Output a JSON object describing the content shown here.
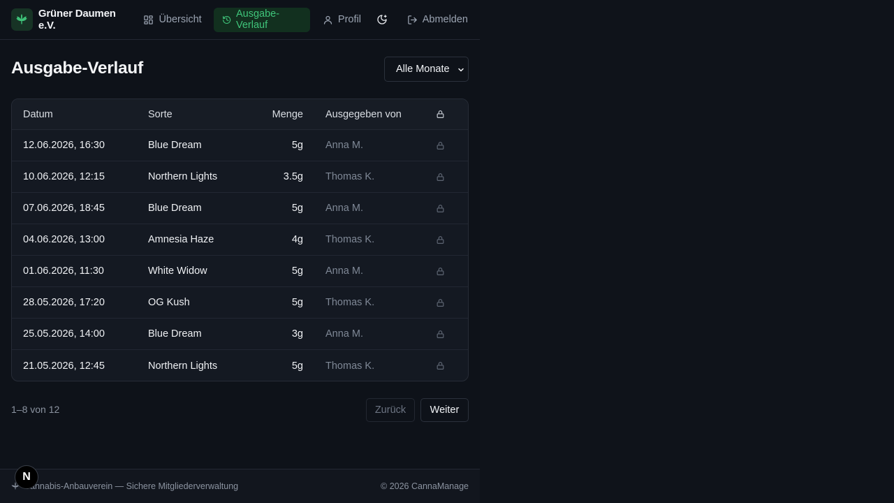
{
  "brand": {
    "name": "Grüner Daumen e.V."
  },
  "nav": {
    "overview": "Übersicht",
    "history": "Ausgabe-Verlauf",
    "profile": "Profil",
    "logout": "Abmelden"
  },
  "page": {
    "title": "Ausgabe-Verlauf",
    "filter_selected": "Alle Monate"
  },
  "table": {
    "columns": [
      "Datum",
      "Sorte",
      "Menge",
      "Ausgegeben von"
    ],
    "rows": [
      {
        "date": "12.06.2026, 16:30",
        "strain": "Blue Dream",
        "amount": "5g",
        "by": "Anna M."
      },
      {
        "date": "10.06.2026, 12:15",
        "strain": "Northern Lights",
        "amount": "3.5g",
        "by": "Thomas K."
      },
      {
        "date": "07.06.2026, 18:45",
        "strain": "Blue Dream",
        "amount": "5g",
        "by": "Anna M."
      },
      {
        "date": "04.06.2026, 13:00",
        "strain": "Amnesia Haze",
        "amount": "4g",
        "by": "Thomas K."
      },
      {
        "date": "01.06.2026, 11:30",
        "strain": "White Widow",
        "amount": "5g",
        "by": "Anna M."
      },
      {
        "date": "28.05.2026, 17:20",
        "strain": "OG Kush",
        "amount": "5g",
        "by": "Thomas K."
      },
      {
        "date": "25.05.2026, 14:00",
        "strain": "Blue Dream",
        "amount": "3g",
        "by": "Anna M."
      },
      {
        "date": "21.05.2026, 12:45",
        "strain": "Northern Lights",
        "amount": "5g",
        "by": "Thomas K."
      }
    ]
  },
  "pagination": {
    "range": "1–8 von 12",
    "prev": "Zurück",
    "next": "Weiter"
  },
  "footer": {
    "tagline": "Cannabis-Anbauverein — Sichere Mitgliederverwaltung",
    "copyright": "© 2026 CannaManage"
  },
  "dev_badge": "N",
  "colors": {
    "accent": "#3fc47a",
    "background": "#0e1219"
  }
}
